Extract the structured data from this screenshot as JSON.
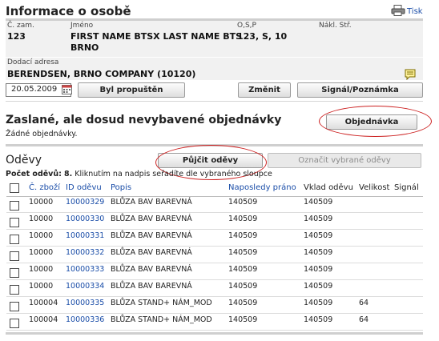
{
  "person": {
    "title": "Informace o osobě",
    "print_label": "Tisk",
    "labels": {
      "emp_no": "Č. zam.",
      "name": "Jméno",
      "osp": "O,S,P",
      "cost_center": "Nákl. Stř."
    },
    "values": {
      "emp_no": "123",
      "name_line1": "FIRST NAME BTSX LAST NAME BTS",
      "name_line2": "BRNO",
      "osp": "123, S, 10",
      "cost_center": ""
    },
    "delivery_label": "Dodací adresa",
    "delivery_value": "BERENDSEN, BRNO COMPANY (10120)",
    "date": "20.05.2009",
    "buttons": {
      "released": "Byl propuštěn",
      "change": "Změnit",
      "signal_note": "Signál/Poznámka"
    }
  },
  "orders": {
    "title": "Zaslané, ale dosud nevybavené objednávky",
    "empty_text": "Žádné objednávky.",
    "button": "Objednávka"
  },
  "garments": {
    "title": "Oděvy",
    "count_label": "Počet oděvů:",
    "count": "8",
    "hint": "Kliknutím na nadpis seřadíte dle vybraného sloupce",
    "buttons": {
      "borrow": "Půjčit oděvy",
      "mark": "Označit vybrané oděvy"
    },
    "columns": [
      "Č. zboží",
      "ID oděvu",
      "Popis",
      "Naposledy práno",
      "Vklad oděvu",
      "Velikost",
      "Signál"
    ],
    "rows": [
      {
        "item": "10000",
        "id": "10000329",
        "desc": "BLŮZA BAV BAREVNÁ",
        "washed": "140509",
        "deposit": "140509",
        "size": "",
        "signal": ""
      },
      {
        "item": "10000",
        "id": "10000330",
        "desc": "BLŮZA BAV BAREVNÁ",
        "washed": "140509",
        "deposit": "140509",
        "size": "",
        "signal": ""
      },
      {
        "item": "10000",
        "id": "10000331",
        "desc": "BLŮZA BAV BAREVNÁ",
        "washed": "140509",
        "deposit": "140509",
        "size": "",
        "signal": ""
      },
      {
        "item": "10000",
        "id": "10000332",
        "desc": "BLŮZA BAV BAREVNÁ",
        "washed": "140509",
        "deposit": "140509",
        "size": "",
        "signal": ""
      },
      {
        "item": "10000",
        "id": "10000333",
        "desc": "BLŮZA BAV BAREVNÁ",
        "washed": "140509",
        "deposit": "140509",
        "size": "",
        "signal": ""
      },
      {
        "item": "10000",
        "id": "10000334",
        "desc": "BLŮZA BAV BAREVNÁ",
        "washed": "140509",
        "deposit": "140509",
        "size": "",
        "signal": ""
      },
      {
        "item": "100004",
        "id": "10000335",
        "desc": "BLŮZA STAND+ NÁM_MOD",
        "washed": "140509",
        "deposit": "140509",
        "size": "64",
        "signal": ""
      },
      {
        "item": "100004",
        "id": "10000336",
        "desc": "BLŮZA STAND+ NÁM_MOD",
        "washed": "140509",
        "deposit": "140509",
        "size": "64",
        "signal": ""
      }
    ]
  },
  "colors": {
    "link": "#1a4da8",
    "ellipse": "#cc2020",
    "rule": "#cfcfcf"
  },
  "icons": {
    "print": "printer-icon",
    "note": "note-icon",
    "calendar": "calendar-icon"
  }
}
